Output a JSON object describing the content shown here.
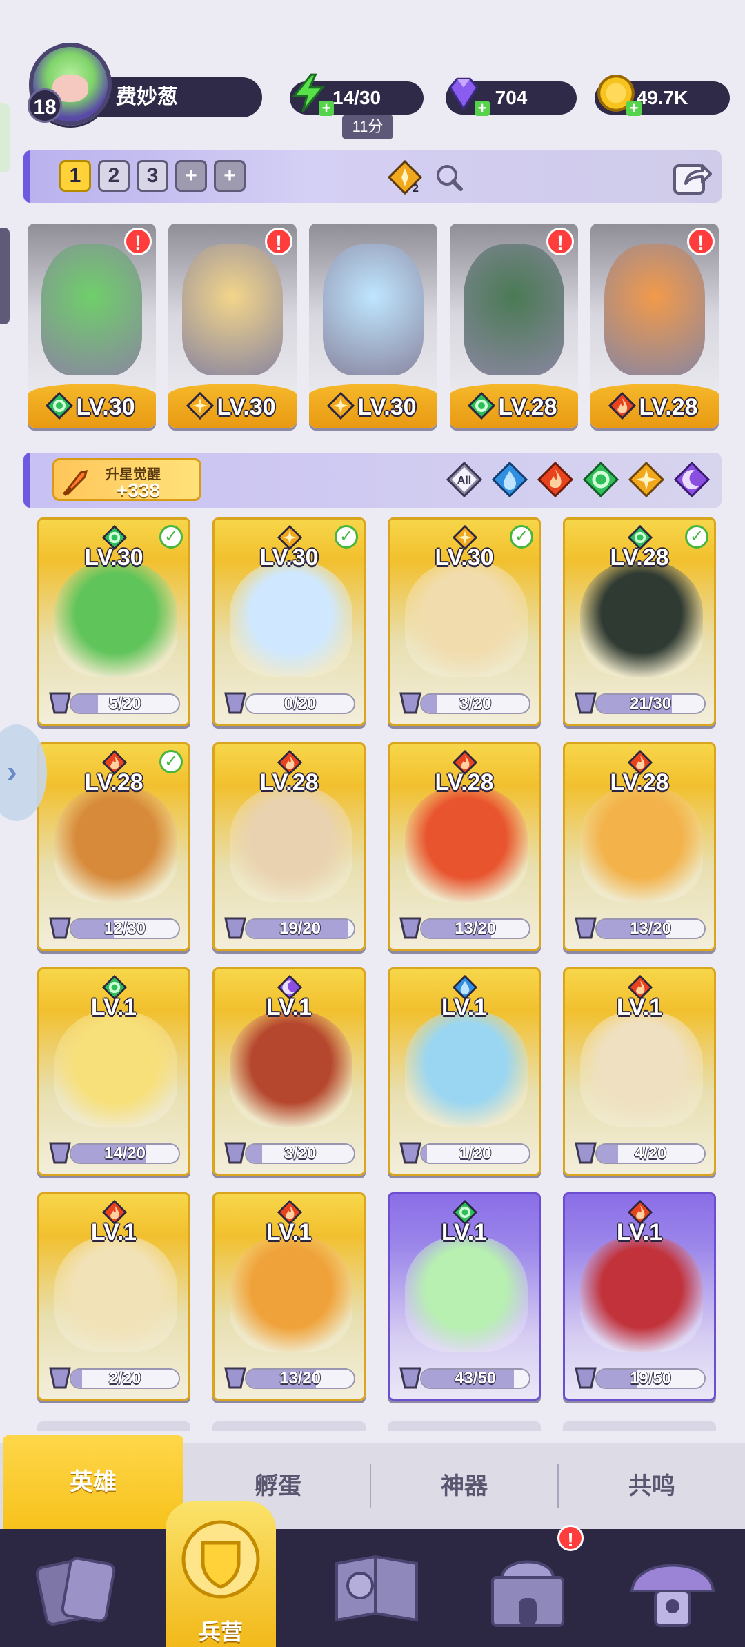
{
  "player": {
    "name": "费妙葱",
    "level": "18"
  },
  "resources": {
    "energy": "14/30",
    "energy_timer": "11分",
    "gems": "704",
    "coins": "49.7K"
  },
  "team_tabs": [
    "1",
    "2",
    "3",
    "+",
    "+"
  ],
  "team_filter_count": "2",
  "team": [
    {
      "level": "LV.30",
      "element": "nature",
      "alert": "!"
    },
    {
      "level": "LV.30",
      "element": "light",
      "alert": "!"
    },
    {
      "level": "LV.30",
      "element": "light",
      "alert": ""
    },
    {
      "level": "LV.28",
      "element": "nature",
      "alert": "!"
    },
    {
      "level": "LV.28",
      "element": "fire",
      "alert": "!"
    }
  ],
  "awaken": {
    "label": "升星觉醒",
    "value": "+338"
  },
  "element_filters": [
    "All",
    "water",
    "fire",
    "nature",
    "light",
    "dark"
  ],
  "heroes": [
    {
      "level": "LV.30",
      "element": "nature",
      "progress": "5/20",
      "fill": 0.25,
      "checked": true,
      "rarity": "gold"
    },
    {
      "level": "LV.30",
      "element": "light",
      "progress": "0/20",
      "fill": 0.0,
      "checked": true,
      "rarity": "gold"
    },
    {
      "level": "LV.30",
      "element": "light",
      "progress": "3/20",
      "fill": 0.15,
      "checked": true,
      "rarity": "gold"
    },
    {
      "level": "LV.28",
      "element": "nature",
      "progress": "21/30",
      "fill": 0.7,
      "checked": true,
      "rarity": "gold"
    },
    {
      "level": "LV.28",
      "element": "fire",
      "progress": "12/30",
      "fill": 0.4,
      "checked": true,
      "rarity": "gold"
    },
    {
      "level": "LV.28",
      "element": "fire",
      "progress": "19/20",
      "fill": 0.95,
      "checked": false,
      "rarity": "gold"
    },
    {
      "level": "LV.28",
      "element": "fire",
      "progress": "13/20",
      "fill": 0.65,
      "checked": false,
      "rarity": "gold"
    },
    {
      "level": "LV.28",
      "element": "fire",
      "progress": "13/20",
      "fill": 0.65,
      "checked": false,
      "rarity": "gold"
    },
    {
      "level": "LV.1",
      "element": "nature",
      "progress": "14/20",
      "fill": 0.7,
      "checked": false,
      "rarity": "gold"
    },
    {
      "level": "LV.1",
      "element": "dark",
      "progress": "3/20",
      "fill": 0.15,
      "checked": false,
      "rarity": "gold"
    },
    {
      "level": "LV.1",
      "element": "water",
      "progress": "1/20",
      "fill": 0.05,
      "checked": false,
      "rarity": "gold"
    },
    {
      "level": "LV.1",
      "element": "fire",
      "progress": "4/20",
      "fill": 0.2,
      "checked": false,
      "rarity": "gold"
    },
    {
      "level": "LV.1",
      "element": "fire",
      "progress": "2/20",
      "fill": 0.1,
      "checked": false,
      "rarity": "gold"
    },
    {
      "level": "LV.1",
      "element": "fire",
      "progress": "13/20",
      "fill": 0.65,
      "checked": false,
      "rarity": "gold"
    },
    {
      "level": "LV.1",
      "element": "nature",
      "progress": "43/50",
      "fill": 0.86,
      "checked": false,
      "rarity": "purple"
    },
    {
      "level": "LV.1",
      "element": "fire",
      "progress": "19/50",
      "fill": 0.38,
      "checked": false,
      "rarity": "purple"
    }
  ],
  "subtabs": [
    "英雄",
    "孵蛋",
    "神器",
    "共鸣"
  ],
  "nav": {
    "active_label": "兵营",
    "alert": "!"
  },
  "colors": {
    "nature": "#2fbf5a",
    "light": "#f2a81c",
    "fire": "#e8431f",
    "water": "#2f8fe0",
    "dark": "#8a4fe0",
    "accent": "#6d5ae0",
    "gold": "#f2c02e"
  }
}
